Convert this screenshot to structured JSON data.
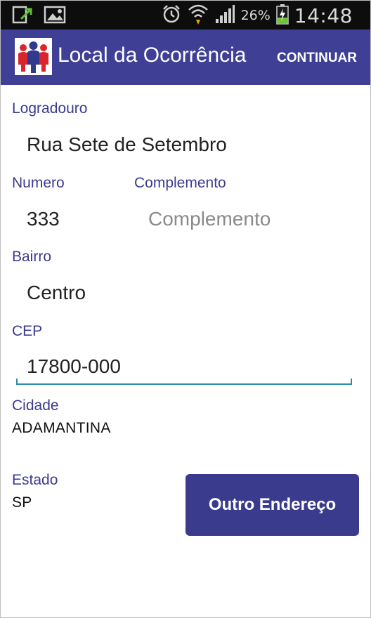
{
  "status_bar": {
    "battery_percent": "26%",
    "time": "14:48",
    "icons": [
      "notification-upload-icon",
      "gallery-icon",
      "alarm-icon",
      "wifi-icon",
      "signal-icon",
      "battery-charging-icon"
    ]
  },
  "app_bar": {
    "title": "Local da Ocorrência",
    "action_label": "CONTINUAR",
    "logo_icon": "people-logo-icon"
  },
  "form": {
    "logradouro": {
      "label": "Logradouro",
      "value": "Rua Sete de Setembro"
    },
    "numero": {
      "label": "Numero",
      "value": "333"
    },
    "complemento": {
      "label": "Complemento",
      "value": "",
      "placeholder": "Complemento"
    },
    "bairro": {
      "label": "Bairro",
      "value": "Centro"
    },
    "cep": {
      "label": "CEP",
      "value": "17800-000"
    },
    "cidade": {
      "label": "Cidade",
      "value": "ADAMANTINA"
    },
    "estado": {
      "label": "Estado",
      "value": "SP"
    }
  },
  "buttons": {
    "other_address": "Outro Endereço"
  },
  "colors": {
    "primary": "#3f3f95",
    "accent": "#2a8fa6",
    "label": "#3b3b8e"
  }
}
